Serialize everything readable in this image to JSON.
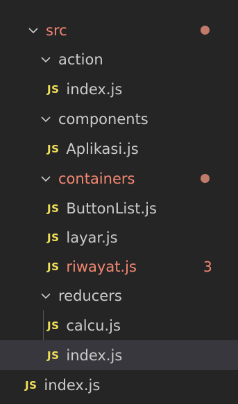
{
  "colors": {
    "background": "#252526",
    "selected_row": "#37373d",
    "text": "#cccccc",
    "modified": "#f48771",
    "js_badge": "#f1e05a",
    "dot": "#c27b6a"
  },
  "tree": [
    {
      "label": "src",
      "kind": "folder",
      "modified": true,
      "decoration": "dot"
    },
    {
      "label": "action",
      "kind": "folder"
    },
    {
      "label": "index.js",
      "kind": "file",
      "icon": "JS"
    },
    {
      "label": "components",
      "kind": "folder"
    },
    {
      "label": "Aplikasi.js",
      "kind": "file",
      "icon": "JS"
    },
    {
      "label": "containers",
      "kind": "folder",
      "modified": true,
      "decoration": "dot"
    },
    {
      "label": "ButtonList.js",
      "kind": "file",
      "icon": "JS"
    },
    {
      "label": "layar.js",
      "kind": "file",
      "icon": "JS"
    },
    {
      "label": "riwayat.js",
      "kind": "file",
      "icon": "JS",
      "modified": true,
      "problems": "3"
    },
    {
      "label": "reducers",
      "kind": "folder"
    },
    {
      "label": "calcu.js",
      "kind": "file",
      "icon": "JS"
    },
    {
      "label": "index.js",
      "kind": "file",
      "icon": "JS",
      "selected": true
    },
    {
      "label": "index.js",
      "kind": "file",
      "icon": "JS"
    }
  ]
}
